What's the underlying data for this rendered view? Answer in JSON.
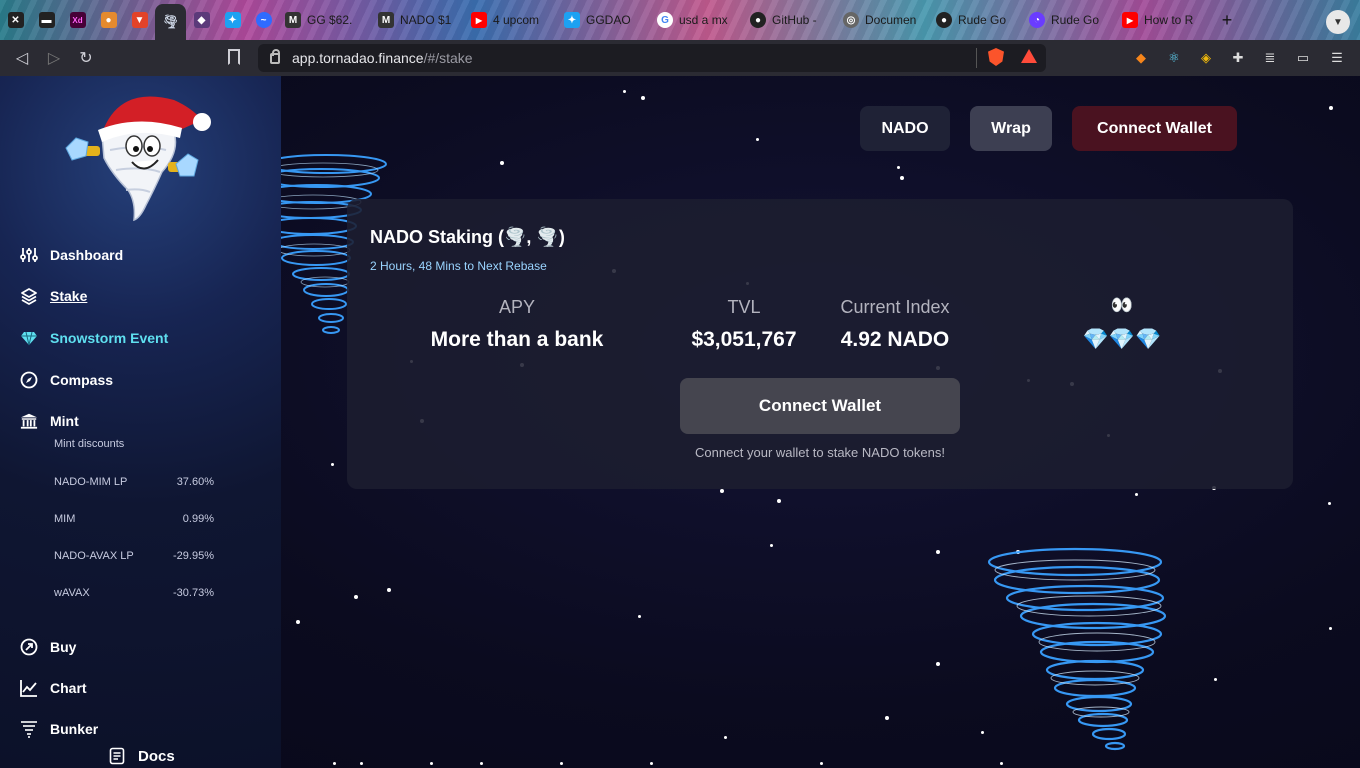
{
  "browser": {
    "tabs": [
      {
        "label": "",
        "icon": "notion-icon",
        "color": "#222"
      },
      {
        "label": "",
        "icon": "terminal-icon",
        "color": "#222"
      },
      {
        "label": "Xd",
        "icon": "adobe-xd-icon",
        "color": "#470137"
      },
      {
        "label": "",
        "icon": "orange-app-icon",
        "color": "#e58a2e"
      },
      {
        "label": "",
        "icon": "gitlab-icon",
        "color": "#e24329"
      },
      {
        "label": "",
        "icon": "tornado-icon",
        "color": "#cfd8e8",
        "active": true
      },
      {
        "label": "",
        "icon": "shield-app-icon",
        "color": "#5b3a7a"
      },
      {
        "label": "",
        "icon": "twitter-icon",
        "color": "#1da1f2"
      },
      {
        "label": "",
        "icon": "messenger-icon",
        "color": "#2f6bff"
      },
      {
        "label": "GG $62.",
        "icon": "gg-icon",
        "color": "#333"
      },
      {
        "label": "NADO $1",
        "icon": "nado-icon",
        "color": "#333"
      },
      {
        "label": "4 upcom",
        "icon": "youtube-icon",
        "color": "#ff0000"
      },
      {
        "label": "GGDAO",
        "icon": "twitter-icon",
        "color": "#1da1f2"
      },
      {
        "label": "usd a mx",
        "icon": "google-icon",
        "color": "#4285f4"
      },
      {
        "label": "GitHub -",
        "icon": "github-icon",
        "color": "#222"
      },
      {
        "label": "Documen",
        "icon": "globe-icon",
        "color": "#666"
      },
      {
        "label": "Rude Go",
        "icon": "rude-icon",
        "color": "#222"
      },
      {
        "label": "Rude Go",
        "icon": "rude-icon",
        "color": "#6a3cff"
      },
      {
        "label": "How to R",
        "icon": "youtube-icon",
        "color": "#ff0000"
      }
    ],
    "new_tab": "+",
    "url_host": "app.tornadao.finance",
    "url_path": "/#/stake"
  },
  "sidebar": {
    "nav_top": [
      {
        "label": "Dashboard",
        "icon": "sliders-icon"
      },
      {
        "label": "Stake",
        "icon": "layers-icon"
      },
      {
        "label": "Snowstorm Event",
        "icon": "diamond-icon"
      },
      {
        "label": "Compass",
        "icon": "compass-icon"
      },
      {
        "label": "Mint",
        "icon": "bank-icon"
      }
    ],
    "discounts_title": "Mint discounts",
    "discounts": [
      {
        "name": "NADO-MIM LP",
        "value": "37.60%"
      },
      {
        "name": "MIM",
        "value": "0.99%"
      },
      {
        "name": "NADO-AVAX LP",
        "value": "-29.95%"
      },
      {
        "name": "wAVAX",
        "value": "-30.73%"
      }
    ],
    "nav_bottom": [
      {
        "label": "Buy",
        "icon": "arrow-up-right-icon"
      },
      {
        "label": "Chart",
        "icon": "chart-line-icon"
      },
      {
        "label": "Bunker",
        "icon": "tornado-small-icon"
      },
      {
        "label": "Docs",
        "icon": "docs-icon"
      }
    ]
  },
  "header": {
    "nado": "NADO",
    "wrap": "Wrap",
    "connect": "Connect Wallet"
  },
  "card": {
    "title": "NADO Staking (🌪️, 🌪️)",
    "subtitle": "2 Hours, 48 Mins to Next Rebase",
    "metrics": [
      {
        "label": "APY",
        "value": "More than a bank"
      },
      {
        "label": "TVL",
        "value": "$3,051,767"
      },
      {
        "label": "Current Index",
        "value": "4.92 NADO"
      },
      {
        "label": "👀",
        "value": "💎💎💎"
      }
    ],
    "connect_button": "Connect Wallet",
    "connect_note": "Connect your wallet to stake NADO tokens!"
  },
  "colors": {
    "connect_header_bg": "#4a1220",
    "event_link": "#5fe0f0",
    "subtitle": "#9ad4ff",
    "tornado_glow": "#3aa0ff"
  }
}
